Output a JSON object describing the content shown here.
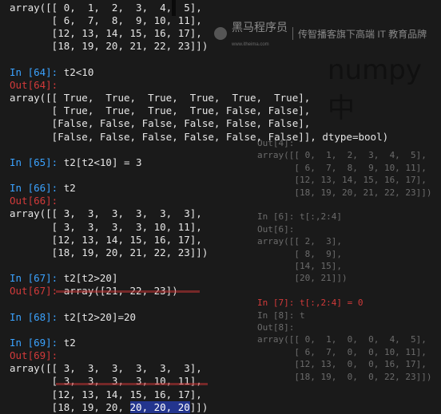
{
  "console": {
    "lines": [
      {
        "name": "t2-output-row-1",
        "parts": [
          {
            "text": "array([[ 0,  1,  2,  3,  4,  5],",
            "cls": ""
          }
        ]
      },
      {
        "name": "t2-output-row-2",
        "parts": [
          {
            "text": "       [ 6,  7,  8,  9, 10, 11],",
            "cls": ""
          }
        ]
      },
      {
        "name": "t2-output-row-3",
        "parts": [
          {
            "text": "       [12, 13, 14, 15, 16, 17],",
            "cls": ""
          }
        ]
      },
      {
        "name": "t2-output-row-4",
        "parts": [
          {
            "text": "       [18, 19, 20, 21, 22, 23]])",
            "cls": ""
          }
        ]
      },
      {
        "name": "spacer",
        "parts": [
          {
            "text": "",
            "cls": ""
          }
        ]
      },
      {
        "name": "in-64-prompt",
        "parts": [
          {
            "text": "In [64]: ",
            "cls": "in"
          },
          {
            "text": "t2<10",
            "cls": ""
          }
        ]
      },
      {
        "name": "out-64-label",
        "parts": [
          {
            "text": "Out[64]:",
            "cls": "out"
          }
        ]
      },
      {
        "name": "bool-row-1",
        "parts": [
          {
            "text": "array([[ True,  True,  True,  True,  True,  True],",
            "cls": ""
          }
        ]
      },
      {
        "name": "bool-row-2",
        "parts": [
          {
            "text": "       [ True,  True,  True,  True, False, False],",
            "cls": ""
          }
        ]
      },
      {
        "name": "bool-row-3",
        "parts": [
          {
            "text": "       [False, False, False, False, False, False],",
            "cls": ""
          }
        ]
      },
      {
        "name": "bool-row-4",
        "parts": [
          {
            "text": "       [False, False, False, False, False, False]], dtype=bool)",
            "cls": ""
          }
        ]
      },
      {
        "name": "spacer",
        "parts": [
          {
            "text": "",
            "cls": ""
          }
        ]
      },
      {
        "name": "in-65-prompt",
        "parts": [
          {
            "text": "In [65]: ",
            "cls": "in"
          },
          {
            "text": "t2[t2<10] = 3",
            "cls": ""
          }
        ]
      },
      {
        "name": "spacer",
        "parts": [
          {
            "text": "",
            "cls": ""
          }
        ]
      },
      {
        "name": "in-66-prompt",
        "parts": [
          {
            "text": "In [66]: ",
            "cls": "in"
          },
          {
            "text": "t2",
            "cls": ""
          }
        ]
      },
      {
        "name": "out-66-label",
        "parts": [
          {
            "text": "Out[66]:",
            "cls": "out"
          }
        ]
      },
      {
        "name": "out-66-row-1",
        "parts": [
          {
            "text": "array([[ 3,  3,  3,  3,  3,  3],",
            "cls": ""
          }
        ]
      },
      {
        "name": "out-66-row-2",
        "parts": [
          {
            "text": "       [ 3,  3,  3,  3, 10, 11],",
            "cls": ""
          }
        ]
      },
      {
        "name": "out-66-row-3",
        "parts": [
          {
            "text": "       [12, 13, 14, 15, 16, 17],",
            "cls": ""
          }
        ]
      },
      {
        "name": "out-66-row-4",
        "parts": [
          {
            "text": "       [18, 19, 20, 21, 22, 23]])",
            "cls": ""
          }
        ]
      },
      {
        "name": "spacer",
        "parts": [
          {
            "text": "",
            "cls": ""
          }
        ]
      },
      {
        "name": "in-67-prompt",
        "parts": [
          {
            "text": "In [67]: ",
            "cls": "in"
          },
          {
            "text": "t2[t2>20]",
            "cls": ""
          }
        ]
      },
      {
        "name": "out-67-line",
        "parts": [
          {
            "text": "Out[67]: ",
            "cls": "out"
          },
          {
            "text": "array([21, 22, 23])",
            "cls": ""
          }
        ]
      },
      {
        "name": "spacer",
        "parts": [
          {
            "text": "",
            "cls": ""
          }
        ]
      },
      {
        "name": "in-68-prompt",
        "parts": [
          {
            "text": "In [68]: ",
            "cls": "in"
          },
          {
            "text": "t2[t2>20]=20",
            "cls": ""
          }
        ]
      },
      {
        "name": "spacer",
        "parts": [
          {
            "text": "",
            "cls": ""
          }
        ]
      },
      {
        "name": "in-69-prompt",
        "parts": [
          {
            "text": "In [69]: ",
            "cls": "in"
          },
          {
            "text": "t2",
            "cls": ""
          }
        ]
      },
      {
        "name": "out-69-label",
        "parts": [
          {
            "text": "Out[69]:",
            "cls": "out"
          }
        ]
      },
      {
        "name": "out-69-row-1",
        "parts": [
          {
            "text": "array([[ 3,  3,  3,  3,  3,  3],",
            "cls": ""
          }
        ]
      },
      {
        "name": "out-69-row-2",
        "parts": [
          {
            "text": "       [ 3,  3,  3,  3, 10, 11],",
            "cls": ""
          }
        ]
      },
      {
        "name": "out-69-row-3",
        "parts": [
          {
            "text": "       [12, 13, 14, 15, 16, 17],",
            "cls": ""
          }
        ]
      },
      {
        "name": "out-69-row-4",
        "parts": [
          {
            "text": "       [18, 19, 20, ",
            "cls": ""
          },
          {
            "text": "20, 20, 20",
            "cls": "hl"
          },
          {
            "text": "]])",
            "cls": ""
          }
        ]
      }
    ]
  },
  "background_slide": {
    "brand": "黑马程序员",
    "brand_sub": "www.itheima.com",
    "slogan": "传智播客旗下高端 IT 教育品牌",
    "title": "numpy中",
    "lines": [
      {
        "name": "bg-out-label",
        "parts": [
          {
            "text": "Out[4]:",
            "cls": ""
          }
        ]
      },
      {
        "name": "bg-array-row-1",
        "parts": [
          {
            "text": "array([[ 0,  1,  2,  3,  4,  5],",
            "cls": ""
          }
        ]
      },
      {
        "name": "bg-array-row-2",
        "parts": [
          {
            "text": "       [ 6,  7,  8,  9, 10, 11],",
            "cls": ""
          }
        ]
      },
      {
        "name": "bg-array-row-3",
        "parts": [
          {
            "text": "       [12, 13, 14, 15, 16, 17],",
            "cls": ""
          }
        ]
      },
      {
        "name": "bg-array-row-4",
        "parts": [
          {
            "text": "       [18, 19, 20, 21, 22, 23]])",
            "cls": ""
          }
        ]
      },
      {
        "name": "spacer",
        "parts": [
          {
            "text": "",
            "cls": ""
          }
        ]
      },
      {
        "name": "bg-in-6",
        "parts": [
          {
            "text": "In [6]: t[:,2:4]",
            "cls": ""
          }
        ]
      },
      {
        "name": "bg-out-6",
        "parts": [
          {
            "text": "Out[6]:",
            "cls": ""
          }
        ]
      },
      {
        "name": "bg-slice-row-1",
        "parts": [
          {
            "text": "array([[ 2,  3],",
            "cls": ""
          }
        ]
      },
      {
        "name": "bg-slice-row-2",
        "parts": [
          {
            "text": "       [ 8,  9],",
            "cls": ""
          }
        ]
      },
      {
        "name": "bg-slice-row-3",
        "parts": [
          {
            "text": "       [14, 15],",
            "cls": ""
          }
        ]
      },
      {
        "name": "bg-slice-row-4",
        "parts": [
          {
            "text": "       [20, 21]])",
            "cls": ""
          }
        ]
      },
      {
        "name": "spacer",
        "parts": [
          {
            "text": "",
            "cls": ""
          }
        ]
      },
      {
        "name": "bg-in-7",
        "parts": [
          {
            "text": "In [7]: t[:,2:4] = 0",
            "cls": "out"
          }
        ]
      },
      {
        "name": "bg-in-8",
        "parts": [
          {
            "text": "In [8]: t",
            "cls": ""
          }
        ]
      },
      {
        "name": "bg-out-8",
        "parts": [
          {
            "text": "Out[8]:",
            "cls": ""
          }
        ]
      },
      {
        "name": "bg-zero-row-1",
        "parts": [
          {
            "text": "array([[ 0,  1,  0,  0,  4,  5],",
            "cls": ""
          }
        ]
      },
      {
        "name": "bg-zero-row-2",
        "parts": [
          {
            "text": "       [ 6,  7,  0,  0, 10, 11],",
            "cls": ""
          }
        ]
      },
      {
        "name": "bg-zero-row-3",
        "parts": [
          {
            "text": "       [12, 13,  0,  0, 16, 17],",
            "cls": ""
          }
        ]
      },
      {
        "name": "bg-zero-row-4",
        "parts": [
          {
            "text": "       [18, 19,  0,  0, 22, 23]])",
            "cls": ""
          }
        ]
      }
    ]
  },
  "colors": {
    "background": "#1a1a1a",
    "text": "#e6e6e6",
    "in_prompt": "#3ba3ff",
    "out_prompt": "#d23a3a",
    "selection": "#23358e"
  }
}
